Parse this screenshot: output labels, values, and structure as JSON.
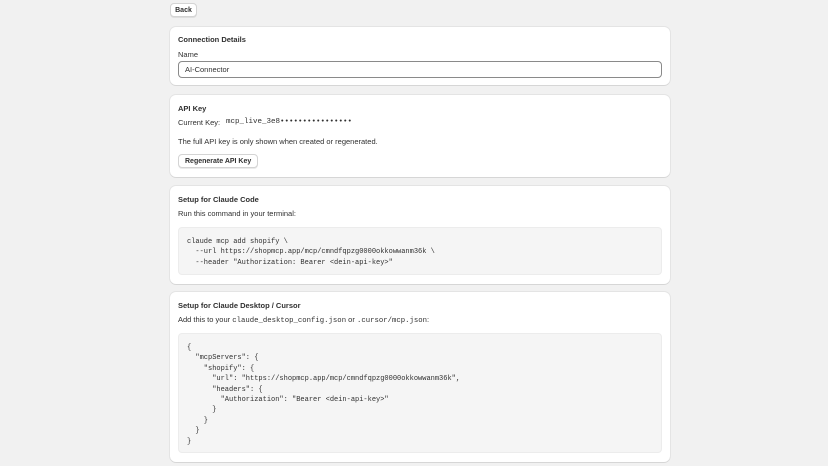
{
  "nav": {
    "back_label": "Back"
  },
  "connection": {
    "title": "Connection Details",
    "name_label": "Name",
    "name_value": "AI-Connector"
  },
  "api_key": {
    "title": "API Key",
    "current_label": "Current Key:",
    "current_value": "mcp_live_3e8••••••••••••••••",
    "note": "The full API key is only shown when created or regenerated.",
    "regenerate_label": "Regenerate API Key"
  },
  "claude_code": {
    "title": "Setup for Claude Code",
    "instruction": "Run this command in your terminal:",
    "command": "claude mcp add shopify \\\n  --url https://shopmcp.app/mcp/cmndfqpzg0000okkowwanm36k \\\n  --header \"Authorization: Bearer <dein-api-key>\""
  },
  "claude_desktop": {
    "title": "Setup for Claude Desktop / Cursor",
    "instruction_prefix": "Add this to your",
    "file1": "claude_desktop_config.json",
    "instruction_or": "or",
    "file2": ".cursor/mcp.json",
    "instruction_suffix": ":",
    "config": "{\n  \"mcpServers\": {\n    \"shopify\": {\n      \"url\": \"https://shopmcp.app/mcp/cmndfqpzg0000okkowwanm36k\",\n      \"headers\": {\n        \"Authorization\": \"Bearer <dein-api-key>\"\n      }\n    }\n  }\n}"
  }
}
